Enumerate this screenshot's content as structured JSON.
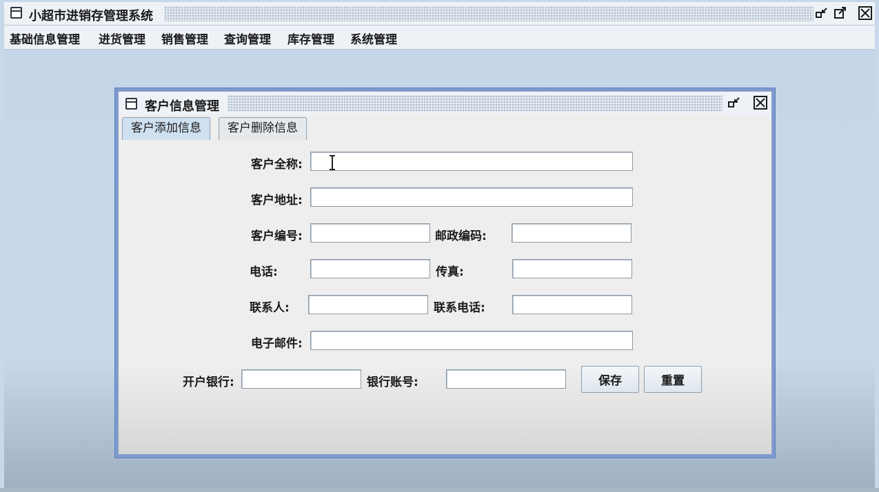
{
  "app": {
    "title": "小超市进销存管理系统"
  },
  "menu": {
    "items": [
      "基础信息管理",
      "进货管理",
      "销售管理",
      "查询管理",
      "库存管理",
      "系统管理"
    ]
  },
  "internal_frame": {
    "title": "客户信息管理",
    "tabs": [
      "客户添加信息",
      "客户删除信息"
    ],
    "active_tab": 0
  },
  "form": {
    "labels": {
      "full_name": "客户全称:",
      "address": "客户地址:",
      "customer_id": "客户编号:",
      "postal_code": "邮政编码:",
      "phone": "电话:",
      "fax": "传真:",
      "contact": "联系人:",
      "contact_phone": "联系电话:",
      "email": "电子邮件:",
      "bank": "开户银行:",
      "bank_account": "银行账号:"
    },
    "values": {
      "full_name": "",
      "address": "",
      "customer_id": "",
      "postal_code": "",
      "phone": "",
      "fax": "",
      "contact": "",
      "contact_phone": "",
      "email": "",
      "bank": "",
      "bank_account": ""
    },
    "buttons": {
      "save": "保存",
      "reset": "重置"
    }
  },
  "icons": {
    "window": "window-icon",
    "iconify": "iconify-icon",
    "maximize": "maximize-icon",
    "close": "close-icon",
    "text_cursor": "i-beam-cursor-icon"
  }
}
